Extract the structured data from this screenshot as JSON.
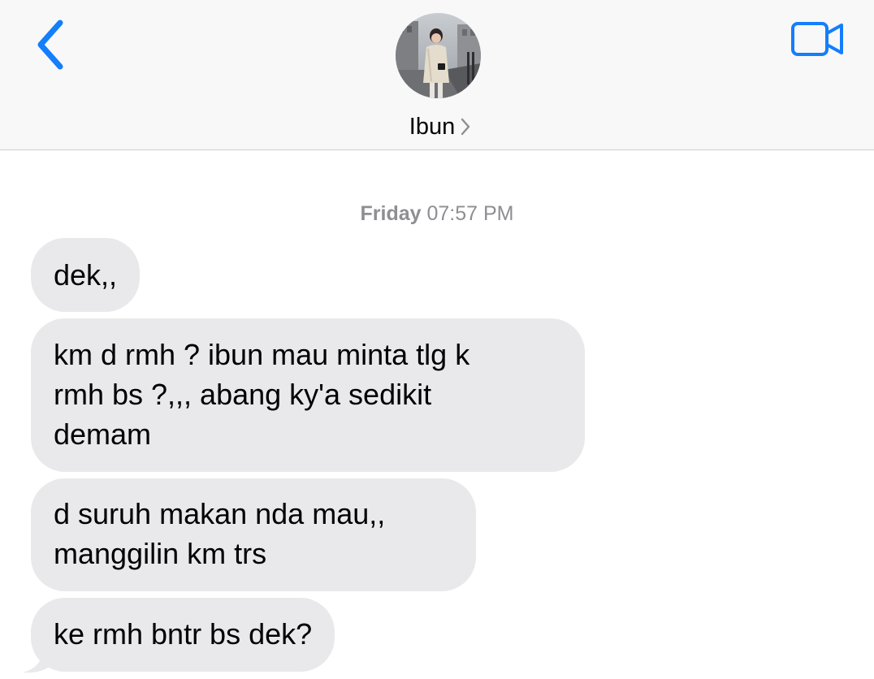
{
  "header": {
    "contact_name": "Ibun",
    "back_icon": "chevron-left-icon",
    "video_icon": "video-camera-icon",
    "accent_color": "#147efb"
  },
  "timestamp": {
    "day": "Friday",
    "time": "07:57 PM"
  },
  "messages": [
    {
      "text": "dek,,"
    },
    {
      "text": "km d rmh ? ibun mau minta tlg k\nrmh bs ?,,, abang ky'a sedikit\ndemam"
    },
    {
      "text": "d suruh makan nda mau,,\nmanggilin km trs"
    },
    {
      "text": "ke rmh bntr bs dek?"
    }
  ],
  "colors": {
    "bubble_received": "#e9e9eb",
    "timestamp": "#8e8e93",
    "header_bg": "#f8f8f8"
  }
}
